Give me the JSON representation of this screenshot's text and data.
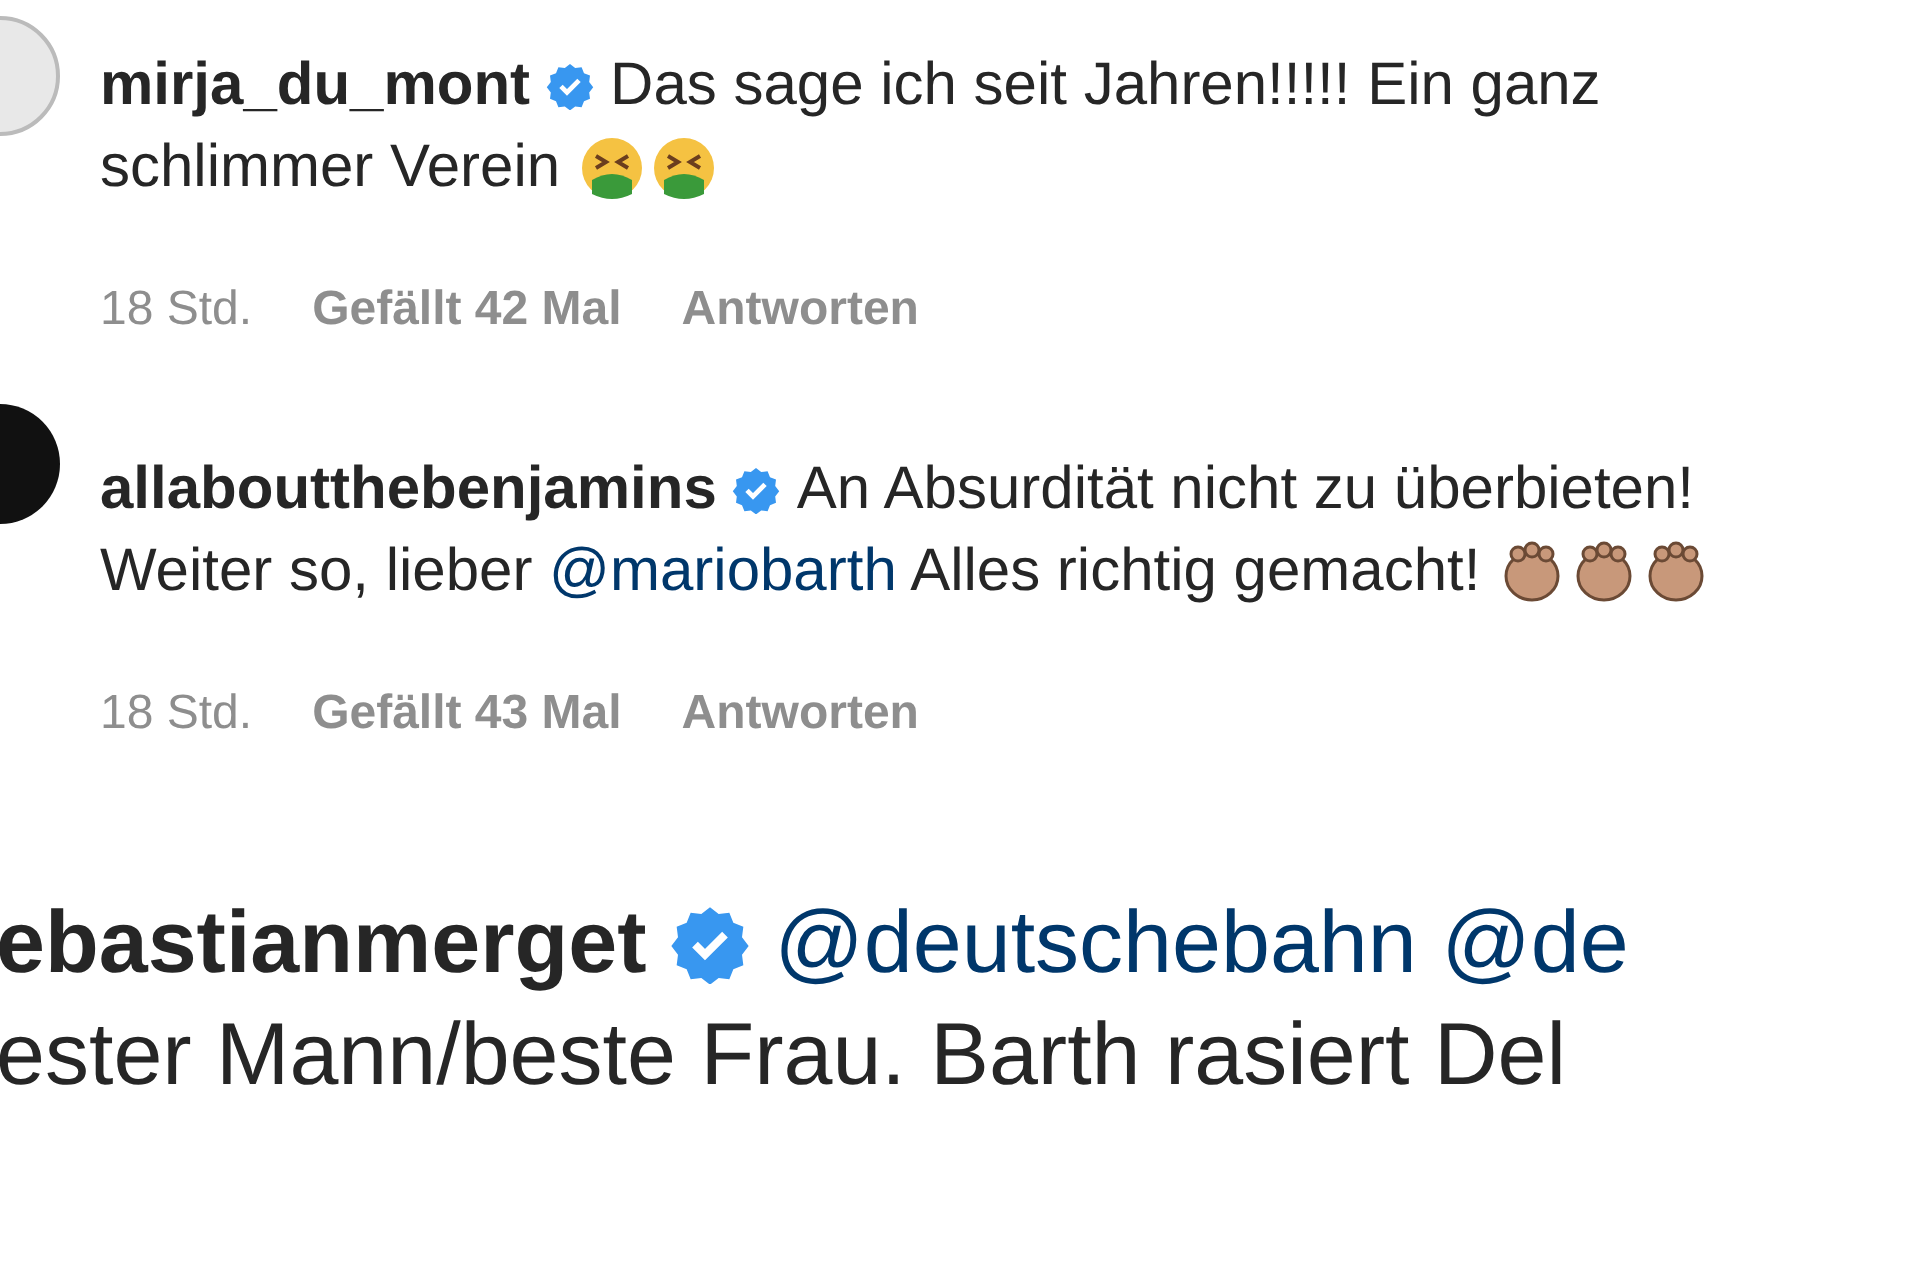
{
  "comments": [
    {
      "avatar": true,
      "username": "mirja_du_mont",
      "verified": true,
      "lines": [
        [
          {
            "kind": "text",
            "text": "Das sage ich seit Jahren!!!!! Ein ganz"
          }
        ],
        [
          {
            "kind": "text",
            "text": "schlimmer Verein"
          }
        ]
      ],
      "emojis": [
        {
          "kind": "vomiting"
        },
        {
          "kind": "vomiting"
        }
      ],
      "meta": {
        "time": "18 Std.",
        "likes": "Gefällt 42 Mal",
        "reply": "Antworten"
      }
    },
    {
      "avatar": true,
      "username": "allaboutthebenjamins",
      "verified": true,
      "lines": [
        [
          {
            "kind": "text",
            "text": "An Absurdität nicht zu überbieten!"
          }
        ],
        [
          {
            "kind": "text",
            "text": "Weiter so, lieber "
          },
          {
            "kind": "mention",
            "text": "@mariobarth"
          },
          {
            "kind": "text",
            "text": " Alles richtig gemacht!"
          }
        ]
      ],
      "emojis": [
        {
          "kind": "clapping"
        },
        {
          "kind": "clapping"
        },
        {
          "kind": "clapping"
        }
      ],
      "meta": {
        "time": "18 Std.",
        "likes": "Gefällt 43 Mal",
        "reply": "Antworten"
      }
    },
    {
      "username": "ebastianmerget",
      "verified": true,
      "lines": [
        [
          {
            "kind": "mention",
            "text": "@deutschebahn"
          },
          {
            "kind": "mention",
            "text": "@de"
          }
        ],
        [
          {
            "kind": "text",
            "text": "ester Mann/beste Frau. Barth rasiert Del"
          }
        ]
      ]
    }
  ]
}
